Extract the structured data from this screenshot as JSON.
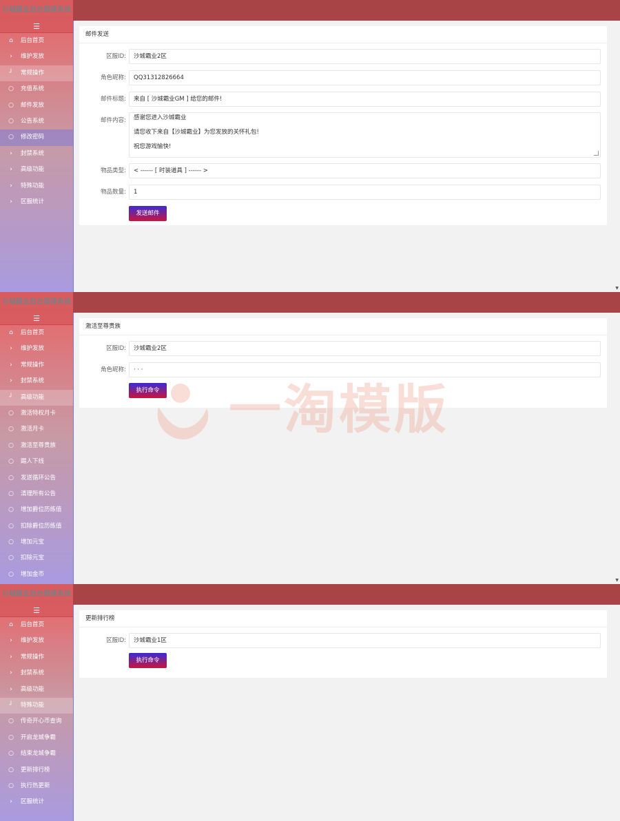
{
  "app": {
    "logo_text": "沙城霸业后台管理系统"
  },
  "ui": {
    "menu_icon": "☰"
  },
  "panel1": {
    "nav": [
      {
        "icon": "home-icon",
        "glyph": "⌂",
        "label": "后台首页"
      },
      {
        "icon": "chevron-right-icon",
        "glyph": "›",
        "label": "维护发放"
      },
      {
        "icon": "corner-icon",
        "glyph": "┘",
        "label": "常规操作"
      },
      {
        "icon": "circle-icon",
        "glyph": "○",
        "label": "充值系统"
      },
      {
        "icon": "circle-icon",
        "glyph": "○",
        "label": "邮件发放"
      },
      {
        "icon": "circle-icon",
        "glyph": "○",
        "label": "公告系统"
      },
      {
        "icon": "circle-icon",
        "glyph": "○",
        "label": "修改密码"
      },
      {
        "icon": "chevron-right-icon",
        "glyph": "›",
        "label": "封禁系统"
      },
      {
        "icon": "chevron-right-icon",
        "glyph": "›",
        "label": "高级功能"
      },
      {
        "icon": "chevron-right-icon",
        "glyph": "›",
        "label": "特殊功能"
      },
      {
        "icon": "chevron-right-icon",
        "glyph": "›",
        "label": "区服统计"
      }
    ],
    "card_title": "邮件发送",
    "fields": {
      "server_label": "区服ID:",
      "server_value": "沙城霸业2区",
      "role_label": "角色昵称:",
      "role_value": "QQ31312826664",
      "title_label": "邮件标题:",
      "title_value": "来自 [ 沙城霸业GM ] 给您的邮件!",
      "content_label": "邮件内容:",
      "content_lines": [
        "感谢您进入沙城霸业",
        "请您收下来自【沙城霸业】为您发放的关怀礼包!",
        "祝您游戏愉快!"
      ],
      "type_label": "物品类型:",
      "type_value": "< ------ [ 时装道具 ] ------ >",
      "qty_label": "物品数量:",
      "qty_value": "1"
    },
    "button": "发送邮件"
  },
  "panel2": {
    "nav": [
      {
        "icon": "home-icon",
        "glyph": "⌂",
        "label": "后台首页"
      },
      {
        "icon": "chevron-right-icon",
        "glyph": "›",
        "label": "维护发放"
      },
      {
        "icon": "chevron-right-icon",
        "glyph": "›",
        "label": "常规操作"
      },
      {
        "icon": "chevron-right-icon",
        "glyph": "›",
        "label": "封禁系统"
      },
      {
        "icon": "corner-icon",
        "glyph": "┘",
        "label": "高级功能"
      },
      {
        "icon": "circle-icon",
        "glyph": "○",
        "label": "激活特权月卡"
      },
      {
        "icon": "circle-icon",
        "glyph": "○",
        "label": "激活月卡"
      },
      {
        "icon": "circle-icon",
        "glyph": "○",
        "label": "激活至尊贵族"
      },
      {
        "icon": "circle-icon",
        "glyph": "○",
        "label": "踢人下线"
      },
      {
        "icon": "circle-icon",
        "glyph": "○",
        "label": "发送循环公告"
      },
      {
        "icon": "circle-icon",
        "glyph": "○",
        "label": "清理所有公告"
      },
      {
        "icon": "circle-icon",
        "glyph": "○",
        "label": "增加爵位历练值"
      },
      {
        "icon": "circle-icon",
        "glyph": "○",
        "label": "扣除爵位历练值"
      },
      {
        "icon": "circle-icon",
        "glyph": "○",
        "label": "增加元宝"
      },
      {
        "icon": "circle-icon",
        "glyph": "○",
        "label": "扣除元宝"
      },
      {
        "icon": "circle-icon",
        "glyph": "○",
        "label": "增加金币"
      }
    ],
    "card_title": "激活至尊贵族",
    "fields": {
      "server_label": "区服ID:",
      "server_value": "沙城霸业2区",
      "role_label": "角色昵称:",
      "role_value": "· · ·"
    },
    "button": "执行命令"
  },
  "panel3": {
    "nav": [
      {
        "icon": "home-icon",
        "glyph": "⌂",
        "label": "后台首页"
      },
      {
        "icon": "chevron-right-icon",
        "glyph": "›",
        "label": "维护发放"
      },
      {
        "icon": "chevron-right-icon",
        "glyph": "›",
        "label": "常规操作"
      },
      {
        "icon": "chevron-right-icon",
        "glyph": "›",
        "label": "封禁系统"
      },
      {
        "icon": "chevron-right-icon",
        "glyph": "›",
        "label": "高级功能"
      },
      {
        "icon": "corner-icon",
        "glyph": "┘",
        "label": "特殊功能"
      },
      {
        "icon": "circle-icon",
        "glyph": "○",
        "label": "传奇开心币查询"
      },
      {
        "icon": "circle-icon",
        "glyph": "○",
        "label": "开启龙城争霸"
      },
      {
        "icon": "circle-icon",
        "glyph": "○",
        "label": "结束龙城争霸"
      },
      {
        "icon": "circle-icon",
        "glyph": "○",
        "label": "更新排行榜"
      },
      {
        "icon": "circle-icon",
        "glyph": "○",
        "label": "执行热更新"
      },
      {
        "icon": "chevron-right-icon",
        "glyph": "›",
        "label": "区服统计"
      }
    ],
    "card_title": "更新排行榜",
    "fields": {
      "server_label": "区服ID:",
      "server_value": "沙城霸业1区"
    },
    "button": "执行命令"
  },
  "watermark": {
    "text": "一淘模版"
  }
}
